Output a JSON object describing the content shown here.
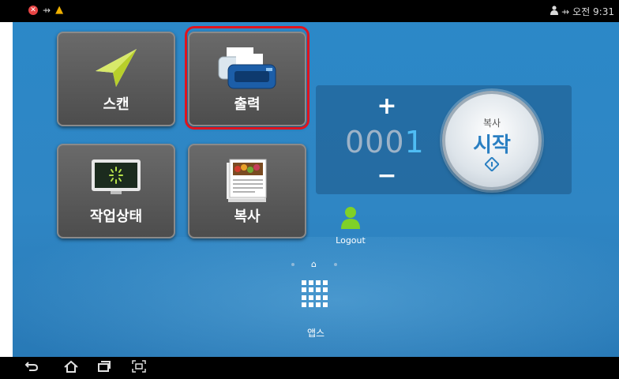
{
  "status_bar": {
    "time": "오전 9:31",
    "icons_left": [
      "error-icon",
      "usb-icon",
      "warning-icon"
    ],
    "icons_right": [
      "user-icon",
      "usb-icon"
    ]
  },
  "tiles": {
    "scan": {
      "label": "스캔",
      "icon": "paper-plane-icon"
    },
    "print": {
      "label": "출력",
      "icon": "printer-icon"
    },
    "job_status": {
      "label": "작업상태",
      "icon": "monitor-loading-icon"
    },
    "copy": {
      "label": "복사",
      "icon": "document-copy-icon"
    }
  },
  "copy_panel": {
    "increment": "+",
    "decrement": "−",
    "count_prefix": "000",
    "count_last": "1",
    "start_sub": "복사",
    "start_main": "시작"
  },
  "logout": {
    "label": "Logout"
  },
  "apps": {
    "label": "앱스"
  },
  "navbar": {
    "icons": [
      "back-icon",
      "home-icon",
      "recent-apps-icon",
      "screenshot-icon"
    ]
  },
  "colors": {
    "highlight": "#e0141e",
    "accent": "#4fbdf4",
    "start_text": "#2a7fc2"
  }
}
